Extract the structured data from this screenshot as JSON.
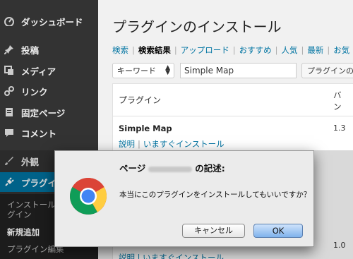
{
  "sidebar": {
    "items": [
      {
        "label": "ダッシュボード",
        "icon": "dashboard-icon"
      },
      {
        "label": "投稿",
        "icon": "pin-icon"
      },
      {
        "label": "メディア",
        "icon": "media-icon"
      },
      {
        "label": "リンク",
        "icon": "link-icon"
      },
      {
        "label": "固定ページ",
        "icon": "page-icon"
      },
      {
        "label": "コメント",
        "icon": "comment-icon"
      },
      {
        "label": "外観",
        "icon": "appearance-icon"
      },
      {
        "label": "プラグイン",
        "icon": "plugin-icon"
      }
    ],
    "submenu": [
      "インストール済みプラグイン",
      "新規追加",
      "プラグイン編集"
    ],
    "active_color": "#0074a2"
  },
  "main": {
    "title": "プラグインのインストール",
    "subnav": [
      "検索",
      "検索結果",
      "アップロード",
      "おすすめ",
      "人気",
      "最新",
      "お気"
    ],
    "filter_select": "キーワード",
    "search_value": "Simple Map",
    "filter_button": "プラグインの",
    "table": {
      "col_plugin": "プラグイン",
      "col_version": "バ\nン",
      "plugin_name": "Simple Map",
      "plugin_version": "1.3",
      "link_details": "説明",
      "link_install": "いますぐインストール",
      "second_version": "1.0",
      "second_links": "説明 | いますぐインストール"
    }
  },
  "dialog": {
    "title_prefix": "ページ",
    "title_suffix": "の記述:",
    "message": "本当にこのプラグインをインストールしてもいいですか？",
    "cancel_label": "キャンセル",
    "ok_label": "OK",
    "icon": "chrome-logo-icon"
  }
}
